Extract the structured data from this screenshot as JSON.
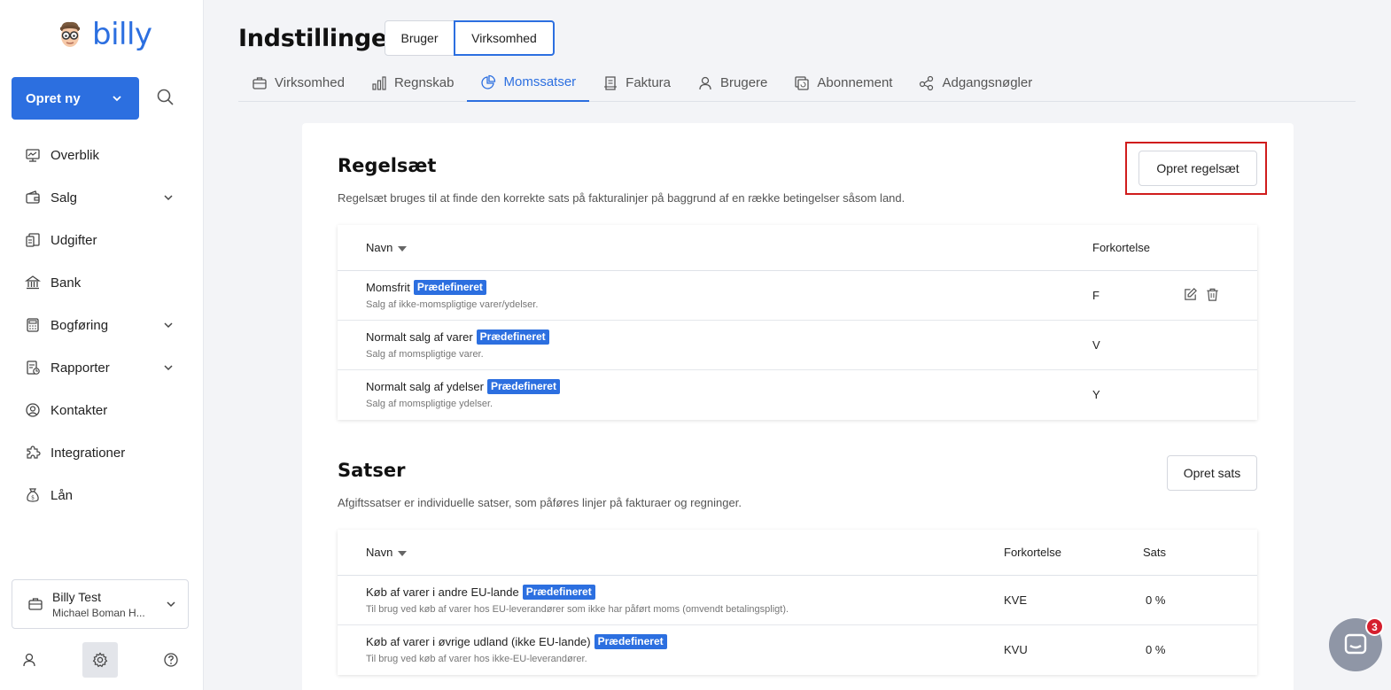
{
  "brand": {
    "name": "billy",
    "color": "#2c6fe0"
  },
  "sidebar": {
    "create_label": "Opret ny",
    "items": [
      {
        "label": "Overblik",
        "icon": "monitor-icon",
        "chevron": false
      },
      {
        "label": "Salg",
        "icon": "wallet-icon",
        "chevron": true
      },
      {
        "label": "Udgifter",
        "icon": "receipt-icon",
        "chevron": false
      },
      {
        "label": "Bank",
        "icon": "bank-icon",
        "chevron": false
      },
      {
        "label": "Bogføring",
        "icon": "calculator-icon",
        "chevron": true
      },
      {
        "label": "Rapporter",
        "icon": "report-icon",
        "chevron": true
      },
      {
        "label": "Kontakter",
        "icon": "contact-icon",
        "chevron": false
      },
      {
        "label": "Integrationer",
        "icon": "puzzle-icon",
        "chevron": false
      },
      {
        "label": "Lån",
        "icon": "moneybag-icon",
        "chevron": false
      }
    ],
    "org": {
      "name": "Billy Test",
      "user": "Michael Boman H..."
    }
  },
  "header": {
    "title": "Indstillinger",
    "toggle": {
      "user": "Bruger",
      "company": "Virksomhed"
    },
    "tabs": [
      {
        "label": "Virksomhed",
        "icon": "briefcase-icon"
      },
      {
        "label": "Regnskab",
        "icon": "bar-chart-icon"
      },
      {
        "label": "Momssatser",
        "icon": "pie-chart-icon",
        "active": true
      },
      {
        "label": "Faktura",
        "icon": "invoice-icon"
      },
      {
        "label": "Brugere",
        "icon": "user-icon"
      },
      {
        "label": "Abonnement",
        "icon": "subscription-icon"
      },
      {
        "label": "Adgangsnøgler",
        "icon": "share-nodes-icon"
      }
    ]
  },
  "rulesets": {
    "title": "Regelsæt",
    "description": "Regelsæt bruges til at finde den korrekte sats på fakturalinjer på baggrund af en række betingelser såsom land.",
    "create_label": "Opret regelsæt",
    "columns": {
      "name": "Navn",
      "abbr": "Forkortelse"
    },
    "rows": [
      {
        "name": "Momsfrit",
        "badge": "Prædefineret",
        "desc": "Salg af ikke-momspligtige varer/ydelser.",
        "abbr": "F"
      },
      {
        "name": "Normalt salg af varer",
        "badge": "Prædefineret",
        "desc": "Salg af momspligtige varer.",
        "abbr": "V"
      },
      {
        "name": "Normalt salg af ydelser",
        "badge": "Prædefineret",
        "desc": "Salg af momspligtige ydelser.",
        "abbr": "Y"
      }
    ]
  },
  "rates": {
    "title": "Satser",
    "description": "Afgiftssatser er individuelle satser, som påføres linjer på fakturaer og regninger.",
    "create_label": "Opret sats",
    "columns": {
      "name": "Navn",
      "abbr": "Forkortelse",
      "rate": "Sats"
    },
    "rows": [
      {
        "name": "Køb af varer i andre EU-lande",
        "badge": "Prædefineret",
        "desc": "Til brug ved køb af varer hos EU-leverandører som ikke har påført moms (omvendt betalingspligt).",
        "abbr": "KVE",
        "rate": "0 %"
      },
      {
        "name": "Køb af varer i øvrige udland (ikke EU-lande)",
        "badge": "Prædefineret",
        "desc": "Til brug ved køb af varer hos ikke-EU-leverandører.",
        "abbr": "KVU",
        "rate": "0 %"
      }
    ]
  },
  "chat": {
    "count": "3"
  }
}
